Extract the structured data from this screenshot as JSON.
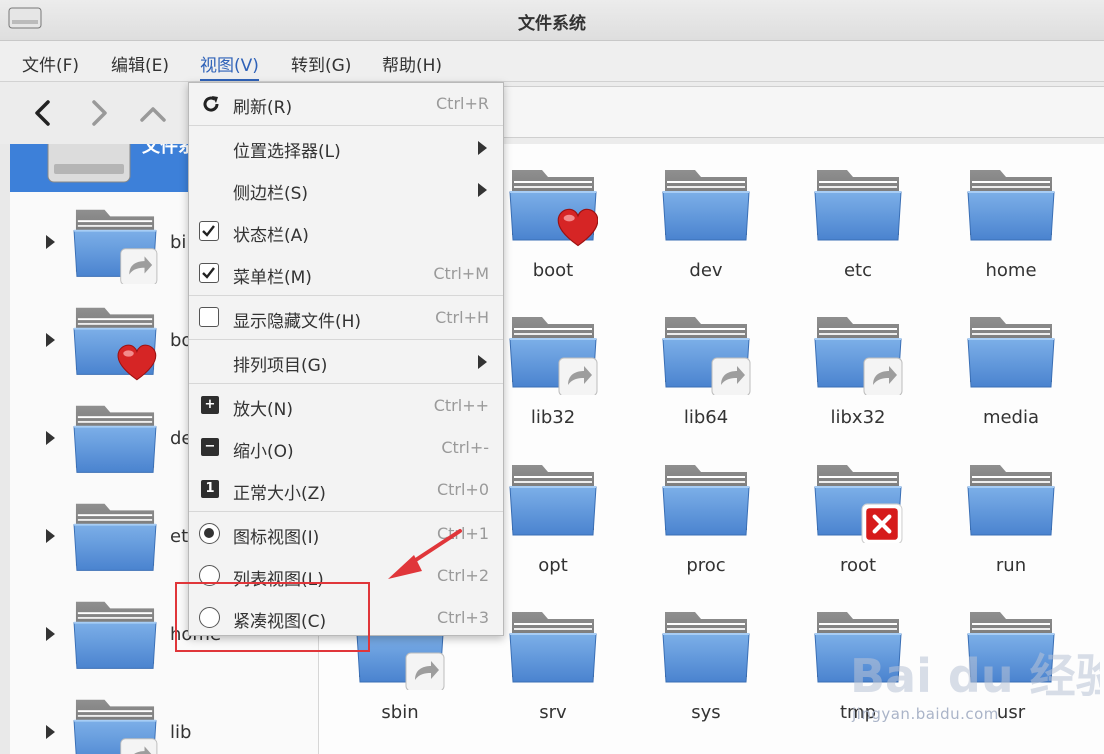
{
  "window": {
    "title": "文件系统"
  },
  "menubar": {
    "items": [
      {
        "label": "文件(F)"
      },
      {
        "label": "编辑(E)"
      },
      {
        "label": "视图(V)"
      },
      {
        "label": "转到(G)"
      },
      {
        "label": "帮助(H)"
      }
    ]
  },
  "sidebar": {
    "root_label": "文件系",
    "items": [
      {
        "label": "bi",
        "badge": "link"
      },
      {
        "label": "bo",
        "badge": "heart"
      },
      {
        "label": "de",
        "badge": ""
      },
      {
        "label": "et",
        "badge": ""
      },
      {
        "label": "home",
        "badge": ""
      },
      {
        "label": "lib",
        "badge": "link"
      }
    ]
  },
  "content": {
    "items": [
      {
        "label": "boot",
        "badge": "heart"
      },
      {
        "label": "dev",
        "badge": ""
      },
      {
        "label": "etc",
        "badge": ""
      },
      {
        "label": "home",
        "badge": ""
      },
      {
        "label": "lib32",
        "badge": "link"
      },
      {
        "label": "lib64",
        "badge": "link"
      },
      {
        "label": "libx32",
        "badge": "link"
      },
      {
        "label": "media",
        "badge": ""
      },
      {
        "label": "opt",
        "badge": ""
      },
      {
        "label": "proc",
        "badge": ""
      },
      {
        "label": "root",
        "badge": "locked"
      },
      {
        "label": "run",
        "badge": ""
      },
      {
        "label": "sbin",
        "badge": "link"
      },
      {
        "label": "srv",
        "badge": ""
      },
      {
        "label": "sys",
        "badge": ""
      },
      {
        "label": "tmp",
        "badge": ""
      },
      {
        "label": "usr",
        "badge": ""
      }
    ]
  },
  "view_menu": {
    "refresh": {
      "label": "刷新(R)",
      "accel": "Ctrl+R"
    },
    "location_selector": {
      "label": "位置选择器(L)"
    },
    "sidebar": {
      "label": "侧边栏(S)"
    },
    "statusbar": {
      "label": "状态栏(A)",
      "checked": true
    },
    "menubar": {
      "label": "菜单栏(M)",
      "accel": "Ctrl+M",
      "checked": true
    },
    "hidden_files": {
      "label": "显示隐藏文件(H)",
      "accel": "Ctrl+H",
      "checked": false
    },
    "arrange": {
      "label": "排列项目(G)"
    },
    "zoom_in": {
      "label": "放大(N)",
      "accel": "Ctrl++"
    },
    "zoom_out": {
      "label": "缩小(O)",
      "accel": "Ctrl+-"
    },
    "normal_size": {
      "label": "正常大小(Z)",
      "accel": "Ctrl+0"
    },
    "icon_view": {
      "label": "图标视图(I)",
      "accel": "Ctrl+1",
      "selected": true
    },
    "list_view": {
      "label": "列表视图(L)",
      "accel": "Ctrl+2",
      "selected": false
    },
    "compact_view": {
      "label": "紧凑视图(C)",
      "accel": "Ctrl+3",
      "selected": false
    }
  },
  "watermark": {
    "brand": "Bai du 经验",
    "url": "jingyan.baidu.com"
  },
  "colors": {
    "accent": "#3d80d9",
    "folder": "#5b93d6",
    "highlight": "#e0363a"
  }
}
